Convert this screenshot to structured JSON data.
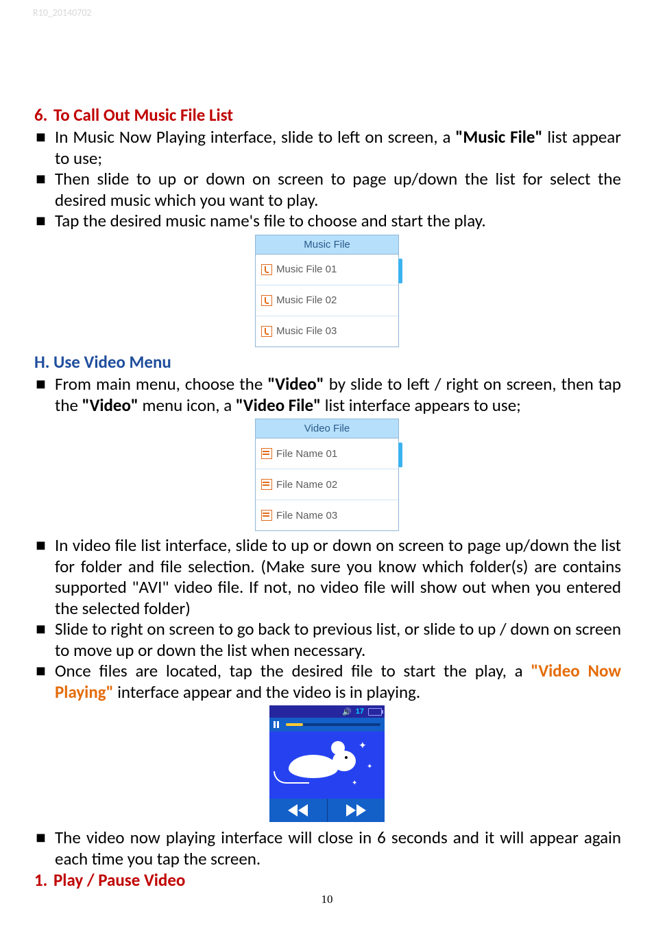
{
  "header_code": "R10_20140702",
  "page_number": "10",
  "section6": {
    "number": "6.",
    "title": "To Call Out Music File List",
    "b1_pre": "In Music Now Playing interface, slide to left on screen, a ",
    "b1_bold": "\"Music File\"",
    "b1_post": " list appear to use;",
    "b2": "Then slide to up or down on screen to page up/down the list for select the desired music which you want to play.",
    "b3": "Tap the desired music name's file to choose and start the play."
  },
  "music_list": {
    "title": "Music File",
    "items": [
      "Music File 01",
      "Music File 02",
      "Music File 03"
    ]
  },
  "sectionH": {
    "letter": "H.",
    "title": "Use Video Menu",
    "b1_a": "From main menu, choose the ",
    "b1_b": "\"Video\"",
    "b1_c": " by slide to left / right on screen, then tap the ",
    "b1_d": "\"Video\"",
    "b1_e": " menu icon, a ",
    "b1_f": "\"Video File\"",
    "b1_g": " list interface appears to use;"
  },
  "video_list": {
    "title": "Video File",
    "items": [
      "File Name 01",
      "File Name 02",
      "File Name 03"
    ]
  },
  "post_video": {
    "b1": "In video file list interface, slide to up or down on screen to page up/down the list for folder and file selection. (Make sure you know which folder(s) are contains supported \"AVI\" video file. If not, no video file will show out when you entered the selected folder)",
    "b2": "Slide to right on screen to go back to previous list, or slide to up / down on screen to move up or down the list when necessary.",
    "b3_a": "Once files are located, tap the desired file to start the play, a ",
    "b3_b": "\"Video Now Playing\"",
    "b3_c": " interface appear and the video is in playing."
  },
  "player": {
    "volume_label": "17"
  },
  "post_player": {
    "b1": "The video now playing interface will close in 6 seconds and it will appear again each time you tap the screen."
  },
  "section1": {
    "number": "1.",
    "title": "Play / Pause Video"
  }
}
